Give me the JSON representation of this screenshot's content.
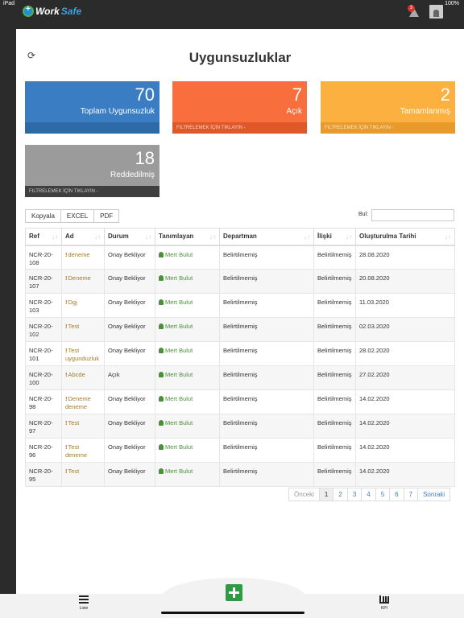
{
  "status": {
    "left": "iPad",
    "right": "100%"
  },
  "app": {
    "logo_work": "Work",
    "logo_safe": "Safe",
    "notif_count": "3"
  },
  "page": {
    "title": "Uygunsuzluklar"
  },
  "cards": [
    {
      "value": "70",
      "label": "Toplam Uygunsuzluk",
      "footer": ""
    },
    {
      "value": "7",
      "label": "Açık",
      "footer": "FILTRELEMEK İÇİN TIKLAYIN -"
    },
    {
      "value": "2",
      "label": "Tamamlanmış",
      "footer": "FILTRELEMEK İÇİN TIKLAYIN -"
    },
    {
      "value": "18",
      "label": "Reddedilmiş",
      "footer": "FILTRELEMEK İÇİN TIKLAYIN -"
    }
  ],
  "toolbar": {
    "copy": "Kopyala",
    "excel": "EXCEL",
    "pdf": "PDF",
    "search_label": "Bul:"
  },
  "table": {
    "headers": [
      "Ref",
      "Ad",
      "Durum",
      "Tanımlayan",
      "Departman",
      "İlişki",
      "Oluşturulma Tarihi"
    ],
    "rows": [
      {
        "ref": "NCR-20-108",
        "ad": "deneme",
        "durum": "Onay Bekliyor",
        "tanim": "Mert Bulut",
        "dept": "Belirtilmemiş",
        "iliski": "Belirtilmemiş",
        "tarih": "28.08.2020"
      },
      {
        "ref": "NCR-20-107",
        "ad": "Deneme",
        "durum": "Onay Bekliyor",
        "tanim": "Mert Bulut",
        "dept": "Belirtilmemiş",
        "iliski": "Belirtilmemiş",
        "tarih": "20.08.2020"
      },
      {
        "ref": "NCR-20-103",
        "ad": "Dgj",
        "durum": "Onay Bekliyor",
        "tanim": "Mert Bulut",
        "dept": "Belirtilmemiş",
        "iliski": "Belirtilmemiş",
        "tarih": "11.03.2020"
      },
      {
        "ref": "NCR-20-102",
        "ad": "Test",
        "durum": "Onay Bekliyor",
        "tanim": "Mert Bulut",
        "dept": "Belirtilmemiş",
        "iliski": "Belirtilmemiş",
        "tarih": "02.03.2020"
      },
      {
        "ref": "NCR-20-101",
        "ad": "Test uygunduzluk",
        "durum": "Onay Bekliyor",
        "tanim": "Mert Bulut",
        "dept": "Belirtilmemiş",
        "iliski": "Belirtilmemiş",
        "tarih": "28.02.2020"
      },
      {
        "ref": "NCR-20-100",
        "ad": "Abcde",
        "durum": "Açık",
        "tanim": "Mert Bulut",
        "dept": "Belirtilmemiş",
        "iliski": "Belirtilmemiş",
        "tarih": "27.02.2020"
      },
      {
        "ref": "NCR-20-98",
        "ad": "Deneme deneme",
        "durum": "Onay Bekliyor",
        "tanim": "Mert Bulut",
        "dept": "Belirtilmemiş",
        "iliski": "Belirtilmemiş",
        "tarih": "14.02.2020"
      },
      {
        "ref": "NCR-20-97",
        "ad": "Test",
        "durum": "Onay Bekliyor",
        "tanim": "Mert Bulut",
        "dept": "Belirtilmemiş",
        "iliski": "Belirtilmemiş",
        "tarih": "14.02.2020"
      },
      {
        "ref": "NCR-20-96",
        "ad": "Test deneme",
        "durum": "Onay Bekliyor",
        "tanim": "Mert Bulut",
        "dept": "Belirtilmemiş",
        "iliski": "Belirtilmemiş",
        "tarih": "14.02.2020"
      },
      {
        "ref": "NCR-20-95",
        "ad": "Test",
        "durum": "Onay Bekliyor",
        "tanim": "Mert Bulut",
        "dept": "Belirtilmemiş",
        "iliski": "Belirtilmemiş",
        "tarih": "14.02.2020"
      }
    ]
  },
  "pagination": {
    "prev": "Önceki",
    "pages": [
      "1",
      "2",
      "3",
      "4",
      "5",
      "6",
      "7"
    ],
    "next": "Sonraki",
    "active": "1"
  },
  "tabs": {
    "list": "Liste",
    "kpi": "KPI"
  },
  "colors": {
    "blue": "#3a7dc3",
    "orange": "#f86e3d",
    "yellow": "#fbb040",
    "gray": "#9b9b9b",
    "green": "#2e9a44"
  }
}
